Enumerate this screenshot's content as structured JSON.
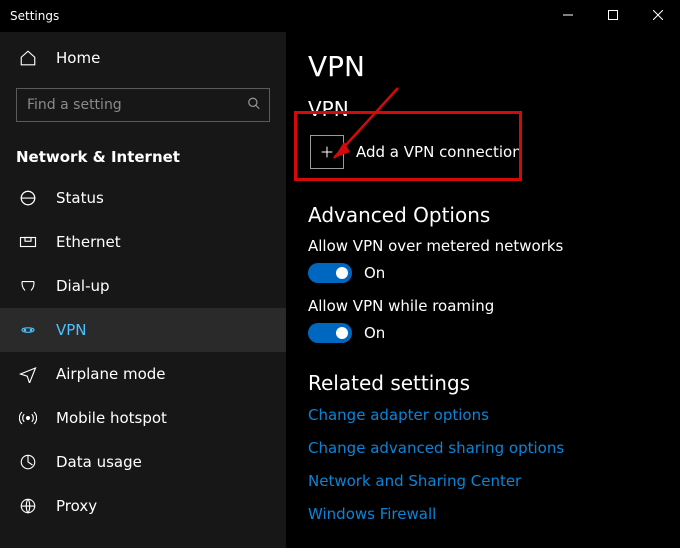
{
  "window": {
    "title": "Settings"
  },
  "sidebar": {
    "home_label": "Home",
    "search_placeholder": "Find a setting",
    "category": "Network & Internet",
    "items": [
      {
        "id": "status",
        "label": "Status",
        "active": false
      },
      {
        "id": "ethernet",
        "label": "Ethernet",
        "active": false
      },
      {
        "id": "dialup",
        "label": "Dial-up",
        "active": false
      },
      {
        "id": "vpn",
        "label": "VPN",
        "active": true
      },
      {
        "id": "airplane",
        "label": "Airplane mode",
        "active": false
      },
      {
        "id": "hotspot",
        "label": "Mobile hotspot",
        "active": false
      },
      {
        "id": "datausage",
        "label": "Data usage",
        "active": false
      },
      {
        "id": "proxy",
        "label": "Proxy",
        "active": false
      }
    ]
  },
  "content": {
    "page_title": "VPN",
    "vpn_section": {
      "heading": "VPN",
      "add_button_label": "Add a VPN connection"
    },
    "advanced": {
      "heading": "Advanced Options",
      "toggles": [
        {
          "label": "Allow VPN over metered networks",
          "state_text": "On",
          "on": true
        },
        {
          "label": "Allow VPN while roaming",
          "state_text": "On",
          "on": true
        }
      ]
    },
    "related": {
      "heading": "Related settings",
      "links": [
        "Change adapter options",
        "Change advanced sharing options",
        "Network and Sharing Center",
        "Windows Firewall"
      ]
    }
  },
  "annotation": {
    "highlight_color": "#d40a0a"
  }
}
